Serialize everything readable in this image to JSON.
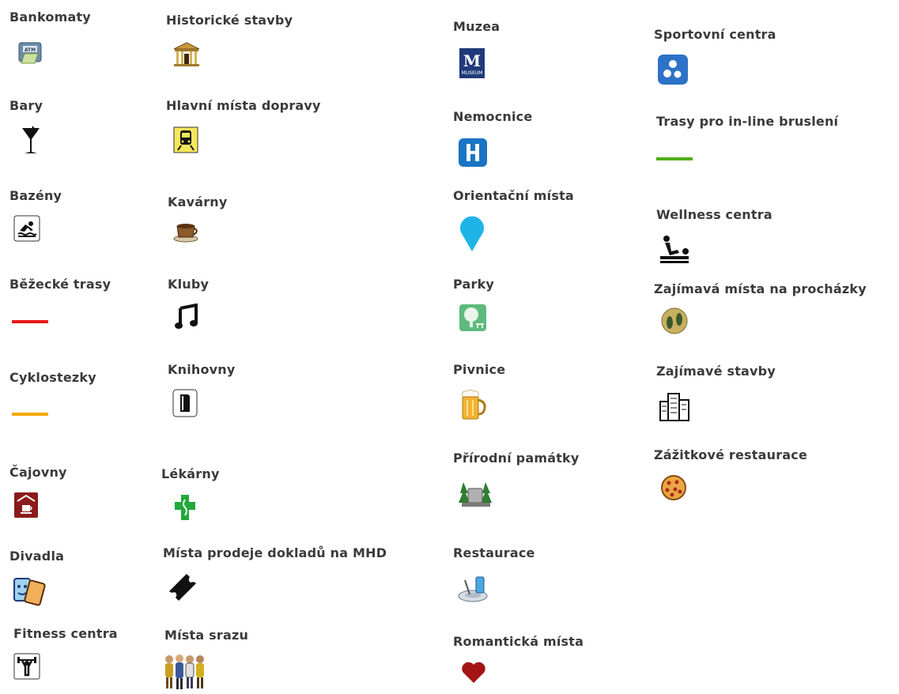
{
  "legend": [
    {
      "label": "Bankomaty",
      "icon": "atm-icon"
    },
    {
      "label": "Bary",
      "icon": "cocktail-glass-icon"
    },
    {
      "label": "Bazény",
      "icon": "swimmer-icon"
    },
    {
      "label": "Běžecké trasy",
      "icon": "red-line-icon",
      "color": "#e8191c"
    },
    {
      "label": "Cyklostezky",
      "icon": "orange-line-icon",
      "color": "#f5a800"
    },
    {
      "label": "Čajovny",
      "icon": "teahouse-icon"
    },
    {
      "label": "Divadla",
      "icon": "theatre-masks-icon"
    },
    {
      "label": "Fitness centra",
      "icon": "weightlifter-icon"
    },
    {
      "label": "Historické stavby",
      "icon": "historic-building-icon"
    },
    {
      "label": "Hlavní místa dopravy",
      "icon": "train-icon"
    },
    {
      "label": "Kavárny",
      "icon": "coffee-cup-icon"
    },
    {
      "label": "Kluby",
      "icon": "music-note-icon"
    },
    {
      "label": "Knihovny",
      "icon": "book-icon"
    },
    {
      "label": "Lékárny",
      "icon": "pharmacy-cross-icon"
    },
    {
      "label": "Místa prodeje dokladů na MHD",
      "icon": "ticket-icon"
    },
    {
      "label": "Místa srazu",
      "icon": "people-group-icon"
    },
    {
      "label": "Muzea",
      "icon": "museum-icon"
    },
    {
      "label": "Nemocnice",
      "icon": "hospital-icon"
    },
    {
      "label": "Orientační místa",
      "icon": "map-pin-icon"
    },
    {
      "label": "Parky",
      "icon": "park-tree-icon"
    },
    {
      "label": "Pivnice",
      "icon": "beer-mug-icon"
    },
    {
      "label": "Přírodní památky",
      "icon": "natural-monument-icon"
    },
    {
      "label": "Restaurace",
      "icon": "restaurant-plate-icon"
    },
    {
      "label": "Romantická místa",
      "icon": "heart-icon"
    },
    {
      "label": "Sportovní centra",
      "icon": "sports-balls-icon"
    },
    {
      "label": "Trasy pro in-line bruslení",
      "icon": "green-line-icon",
      "color": "#4caf1a"
    },
    {
      "label": "Wellness centra",
      "icon": "massage-icon"
    },
    {
      "label": "Zajímavá místa na procházky",
      "icon": "footprints-icon"
    },
    {
      "label": "Zajímavé stavby",
      "icon": "skyscrapers-icon"
    },
    {
      "label": "Zážitkové restaurace",
      "icon": "pizza-icon"
    }
  ]
}
